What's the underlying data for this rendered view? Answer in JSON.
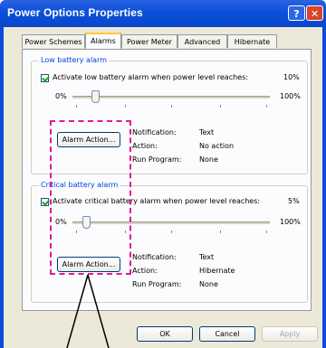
{
  "window": {
    "title": "Power Options Properties",
    "help_glyph": "?",
    "close_glyph": "✕"
  },
  "tabs": [
    "Power Schemes",
    "Alarms",
    "Power Meter",
    "Advanced",
    "Hibernate"
  ],
  "low_alarm": {
    "group_title": "Low battery alarm",
    "checkbox_label": "Activate low battery alarm when power level reaches:",
    "checked": true,
    "level_text": "10%",
    "level_fraction": 0.1,
    "min_label": "0%",
    "max_label": "100%",
    "button_label": "Alarm Action...",
    "info": [
      {
        "label": "Notification:",
        "value": "Text"
      },
      {
        "label": "Action:",
        "value": "No action"
      },
      {
        "label": "Run Program:",
        "value": "None"
      }
    ]
  },
  "critical_alarm": {
    "group_title": "Critical battery alarm",
    "checkbox_label": "Activate critical battery alarm when power level reaches:",
    "checked": true,
    "level_text": "5%",
    "level_fraction": 0.05,
    "min_label": "0%",
    "max_label": "100%",
    "button_label": "Alarm Action...",
    "info": [
      {
        "label": "Notification:",
        "value": "Text"
      },
      {
        "label": "Action:",
        "value": "Hibernate"
      },
      {
        "label": "Run Program:",
        "value": "None"
      }
    ]
  },
  "footer": {
    "ok": "OK",
    "cancel": "Cancel",
    "apply": "Apply"
  },
  "annotation": {
    "color": "#e0189a"
  }
}
